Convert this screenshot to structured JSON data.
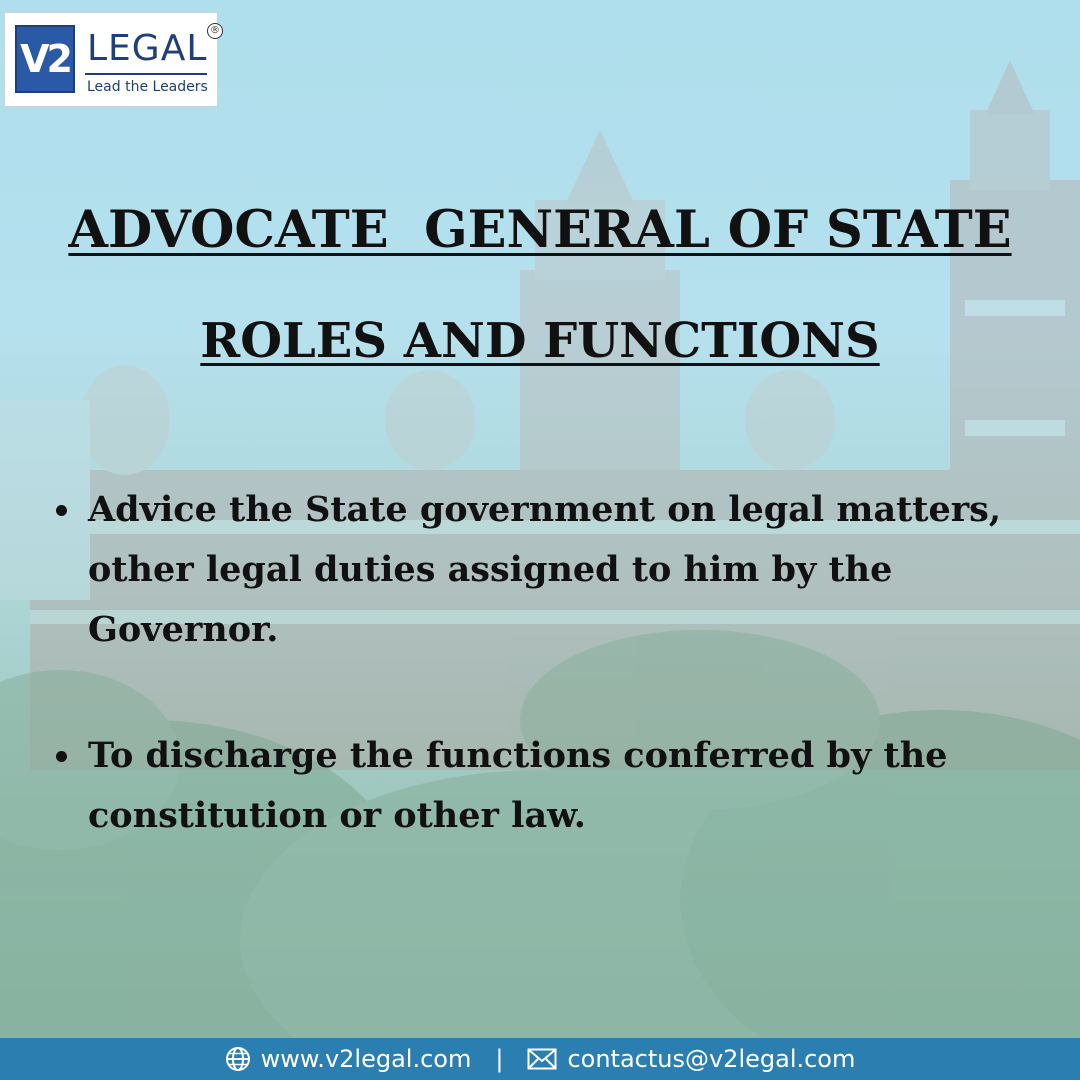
{
  "logo": {
    "mark": "V2",
    "word": "LEGAL",
    "tagline": "Lead the Leaders",
    "registered": "®"
  },
  "title": {
    "line1": "ADVOCATE  GENERAL OF STATE",
    "line2": "ROLES AND FUNCTIONS"
  },
  "points": [
    "Advice the State government on legal matters, other legal duties assigned to him by the Governor.",
    "To discharge the functions conferred by the constitution or other law."
  ],
  "footer": {
    "website": "www.v2legal.com",
    "separator": "|",
    "email": "contactus@v2legal.com",
    "background": "#2a7fb0"
  }
}
